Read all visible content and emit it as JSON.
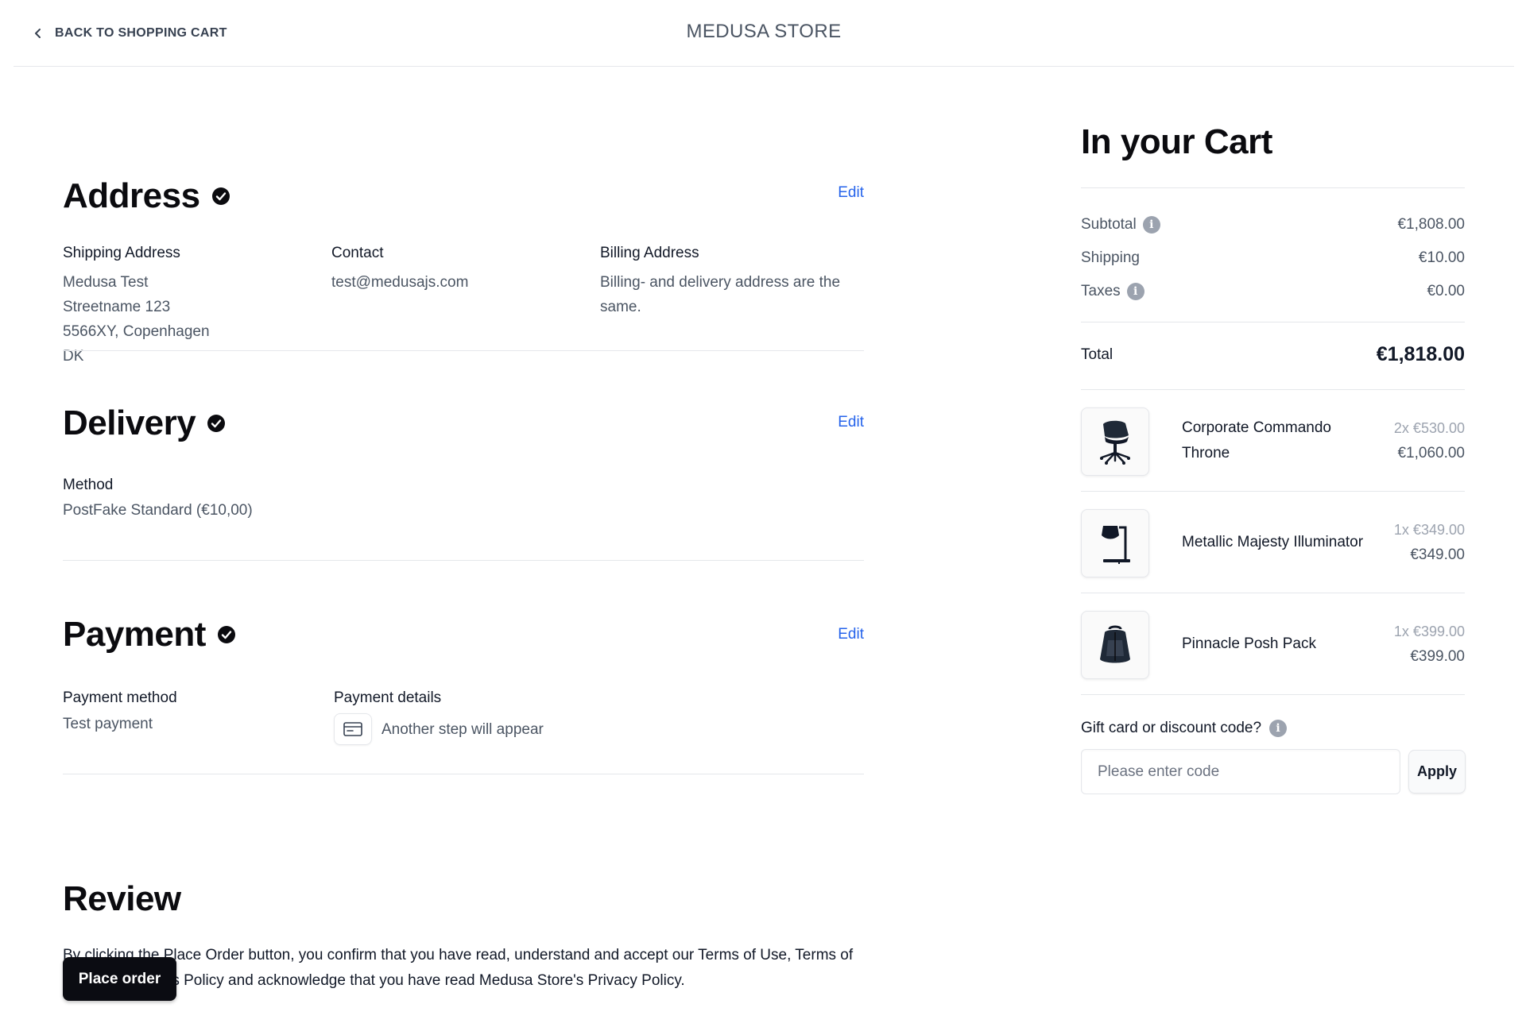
{
  "header": {
    "back_label": "BACK TO SHOPPING CART",
    "store_name": "MEDUSA STORE"
  },
  "address": {
    "title": "Address",
    "edit_label": "Edit",
    "shipping": {
      "label": "Shipping Address",
      "lines": [
        "Medusa Test",
        "Streetname 123",
        "5566XY, Copenhagen",
        "DK"
      ]
    },
    "contact": {
      "label": "Contact",
      "email": "test@medusajs.com"
    },
    "billing": {
      "label": "Billing Address",
      "text": "Billing- and delivery address are the same."
    }
  },
  "delivery": {
    "title": "Delivery",
    "edit_label": "Edit",
    "method_label": "Method",
    "method_value": "PostFake Standard (€10,00)"
  },
  "payment": {
    "title": "Payment",
    "edit_label": "Edit",
    "method_label": "Payment method",
    "method_value": "Test payment",
    "details_label": "Payment details",
    "details_value": "Another step will appear"
  },
  "review": {
    "title": "Review",
    "terms": "By clicking the Place Order button, you confirm that you have read, understand and accept our Terms of Use, Terms of Sale and Returns Policy and acknowledge that you have read Medusa Store's Privacy Policy.",
    "place_order_label": "Place order"
  },
  "cart": {
    "title": "In your Cart",
    "subtotal_label": "Subtotal",
    "subtotal_value": "€1,808.00",
    "shipping_label": "Shipping",
    "shipping_value": "€10.00",
    "taxes_label": "Taxes",
    "taxes_value": "€0.00",
    "total_label": "Total",
    "total_value": "€1,818.00",
    "items": [
      {
        "name": "Corporate Commando Throne",
        "qty_price": "2x €530.00",
        "total": "€1,060.00",
        "icon": "office-chair-icon"
      },
      {
        "name": "Metallic Majesty Illuminator",
        "qty_price": "1x €349.00",
        "total": "€349.00",
        "icon": "desk-lamp-icon"
      },
      {
        "name": "Pinnacle Posh Pack",
        "qty_price": "1x €399.00",
        "total": "€399.00",
        "icon": "backpack-icon"
      }
    ],
    "gift_label": "Gift card or discount code?",
    "code_placeholder": "Please enter code",
    "code_value": "",
    "apply_label": "Apply"
  },
  "colors": {
    "accent_link": "#2563eb",
    "primary_button": "#0b0c12",
    "info_icon": "#9ca3af"
  }
}
